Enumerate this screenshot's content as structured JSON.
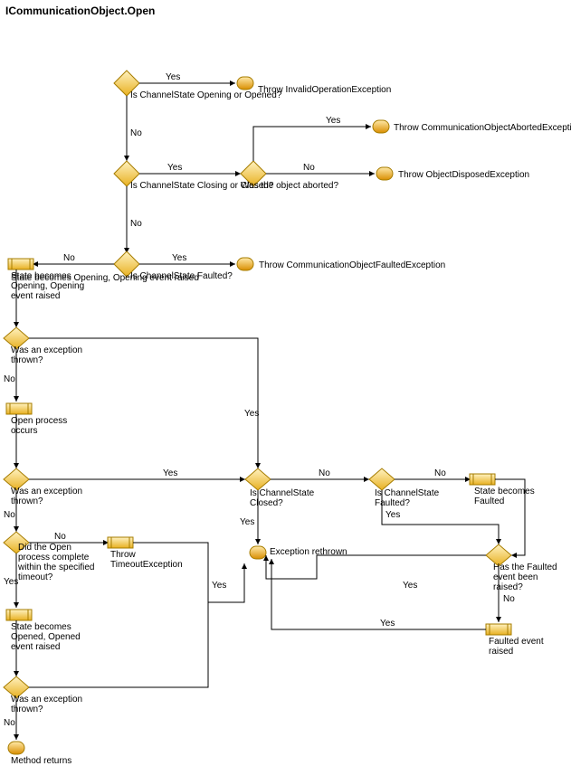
{
  "title": "ICommunicationObject.Open",
  "nodes": {
    "d1": "Is ChannelState Opening or Opened?",
    "t1": "Throw InvalidOperationException",
    "d2": "Is ChannelState Closing or Closed?",
    "d3": "Was the object aborted?",
    "t2": "Throw CommunicationObjectAbortedException",
    "t3": "Throw ObjectDisposedException",
    "d4": "Is ChannelState Faulted?",
    "t4": "Throw CommunicationObjectFaultedException",
    "p1": "State becomes Opening, Opening event raised",
    "d5": "Was an exception thrown?",
    "p2": "Open process occurs",
    "d6": "Was an exception thrown?",
    "d7": "Did the Open process complete within the specified timeout?",
    "t5": "Throw TimeoutException",
    "p3": "State becomes Opened, Opened event raised",
    "d8": "Was an exception thrown?",
    "t6": "Method returns",
    "d9": "Is ChannelState Closed?",
    "d10": "Is ChannelState Faulted?",
    "p4": "State becomes Faulted",
    "t7": "Exception rethrown",
    "d11": "Has the Faulted event been raised?",
    "p5": "Faulted event raised"
  },
  "labels": {
    "yes": "Yes",
    "no": "No"
  }
}
